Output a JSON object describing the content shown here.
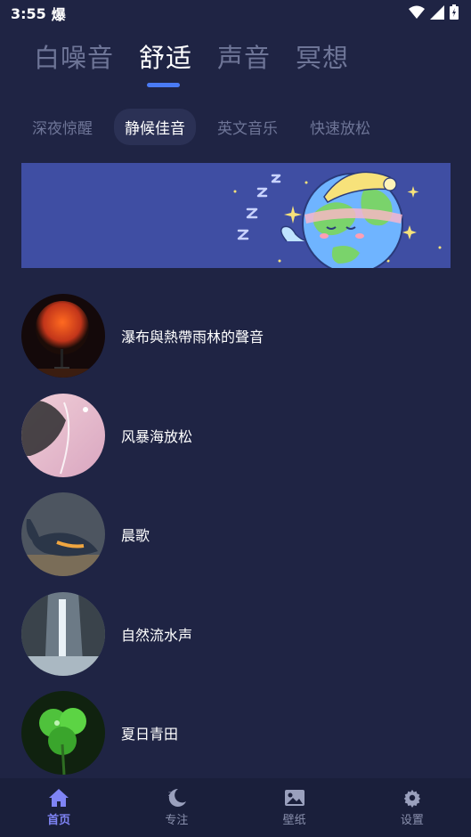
{
  "status_bar": {
    "time": "3:55",
    "notification_glyph": "爆"
  },
  "main_tabs": [
    {
      "label": "白噪音",
      "active": false
    },
    {
      "label": "舒适",
      "active": true
    },
    {
      "label": "声音",
      "active": false
    },
    {
      "label": "冥想",
      "active": false
    }
  ],
  "sub_tabs": [
    {
      "label": "深夜惊醒",
      "active": false
    },
    {
      "label": "静候佳音",
      "active": true
    },
    {
      "label": "英文音乐",
      "active": false
    },
    {
      "label": "快速放松",
      "active": false
    }
  ],
  "tracks": [
    {
      "title": "瀑布與熱帶雨林的聲音",
      "cover": "sunset-lamp"
    },
    {
      "title": "风暴海放松",
      "cover": "storm-sea"
    },
    {
      "title": "晨歌",
      "cover": "whale-lamp"
    },
    {
      "title": "自然流水声",
      "cover": "waterfall"
    },
    {
      "title": "夏日青田",
      "cover": "clover"
    }
  ],
  "bottom_nav": [
    {
      "label": "首页",
      "icon": "home-icon",
      "active": true
    },
    {
      "label": "专注",
      "icon": "moon-icon",
      "active": false
    },
    {
      "label": "壁纸",
      "icon": "image-icon",
      "active": false
    },
    {
      "label": "设置",
      "icon": "gear-icon",
      "active": false
    }
  ],
  "colors": {
    "background": "#1f2444",
    "accent": "#4a7bf5",
    "active_nav": "#7f84f5",
    "banner": "#3f4ea3"
  }
}
